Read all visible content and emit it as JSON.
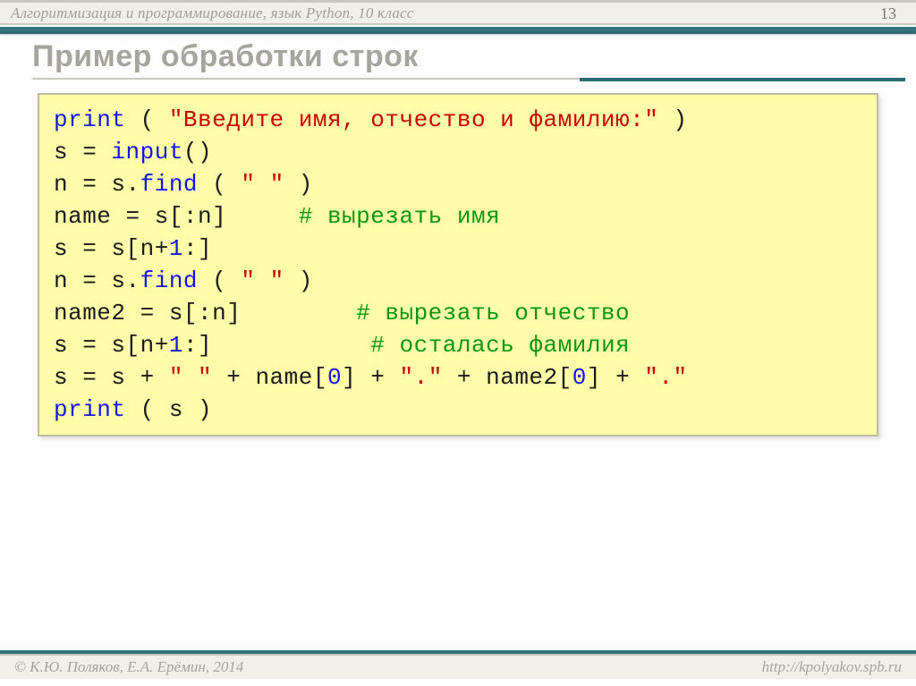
{
  "header": {
    "course": "Алгоритмизация и программирование, язык Python, 10 класс",
    "page_number": "13"
  },
  "title": "Пример обработки строк",
  "code": {
    "tokens": {
      "print": "print",
      "input": "input",
      "find": "find",
      "lparen": "(",
      "rparen": ")",
      "space_paren": " ( ",
      "close_paren": " )",
      "brack": "()",
      "str_prompt": "\"Введите имя, отчество и фамилию:\"",
      "str_sp": "\" \"",
      "str_dot": "\".\"",
      "num0": "0",
      "num1": "1",
      "s_eq": "s = ",
      "n_eq": "n = s.",
      "name_eq": "name = s[:n]",
      "name2_eq": "name2 = s[:n]",
      "slice": "s = s[n+",
      "slice_end": ":]",
      "concat_a": "s = s + ",
      "concat_b": " + name[",
      "concat_c": "] + ",
      "concat_d": " + name2[",
      "concat_e": "] + ",
      "var_s": "s",
      "cmt1": "# вырезать имя",
      "cmt2": "# вырезать отчество",
      "cmt3": "# осталась фамилия"
    }
  },
  "footer": {
    "copyright": "© К.Ю. Поляков, Е.А. Ерёмин, 2014",
    "url": "http://kpolyakov.spb.ru"
  }
}
